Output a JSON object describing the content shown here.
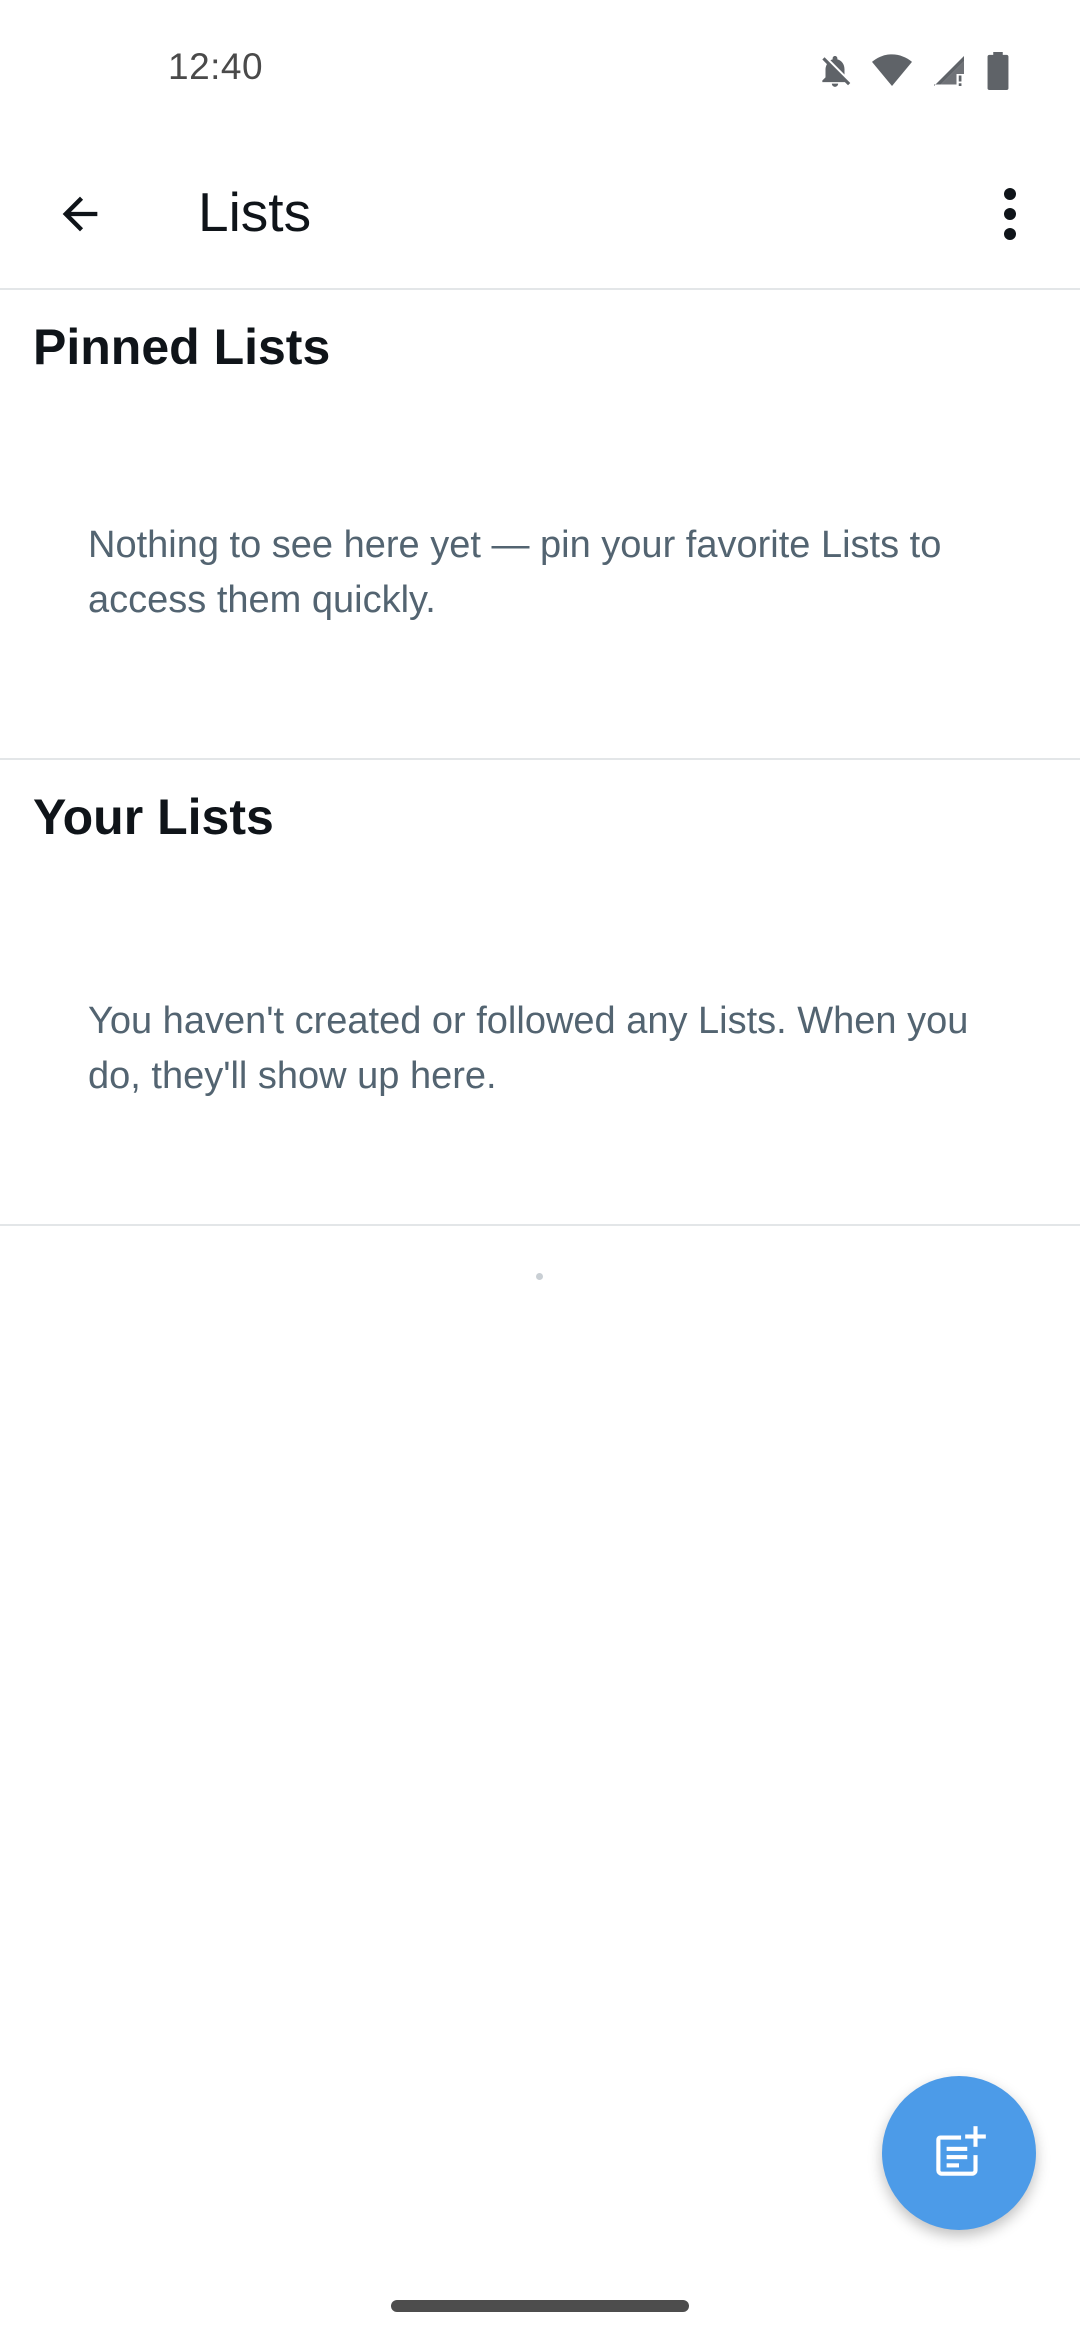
{
  "status_bar": {
    "time": "12:40",
    "icons": [
      "notifications-off-icon",
      "wifi-icon",
      "signal-icon",
      "battery-icon"
    ]
  },
  "app_bar": {
    "back_icon": "arrow-left-icon",
    "title": "Lists",
    "overflow_icon": "more-vertical-icon"
  },
  "sections": [
    {
      "title": "Pinned Lists",
      "empty_message": "Nothing to see here yet — pin your favorite Lists to access them quickly."
    },
    {
      "title": "Your Lists",
      "empty_message": "You haven't created or followed any Lists. When you do, they'll show up here."
    }
  ],
  "fab": {
    "icon": "new-list-icon"
  },
  "colors": {
    "accent": "#4c9be8",
    "primary_text": "#0f1419",
    "secondary_text": "#536471",
    "divider": "#e3e6e8"
  }
}
